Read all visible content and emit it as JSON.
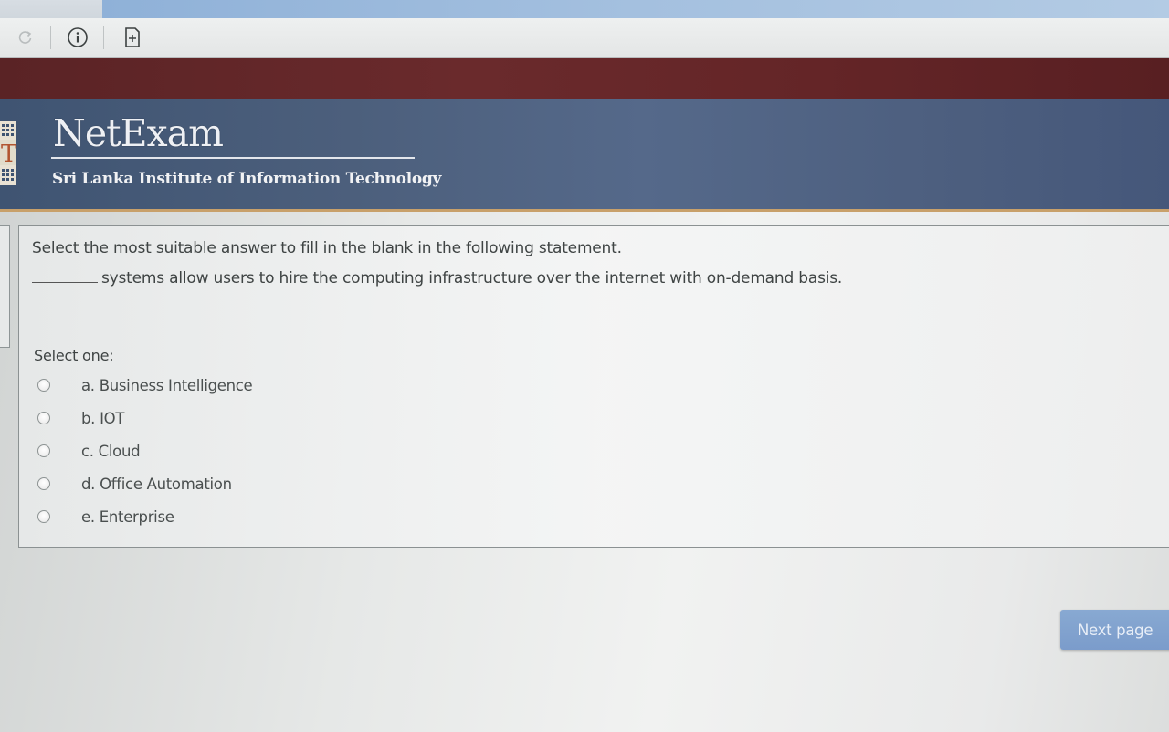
{
  "browser": {
    "reload_icon": "reload-icon",
    "info_icon": "info-icon",
    "page_icon": "add-page-icon"
  },
  "header": {
    "brand": "NetExam",
    "institution": "Sri Lanka Institute of Information Technology",
    "logo_letter": "T",
    "band_color": "#632527",
    "banner_color": "#4d6080"
  },
  "question": {
    "prompt": "Select the most suitable answer to fill in the blank in the following statement.",
    "statement": "systems allow users to hire the computing infrastructure over the internet with on-demand basis.",
    "select_label": "Select one:",
    "options": [
      {
        "label": "a. Business Intelligence"
      },
      {
        "label": "b. IOT"
      },
      {
        "label": "c. Cloud"
      },
      {
        "label": "d. Office Automation"
      },
      {
        "label": "e. Enterprise"
      }
    ]
  },
  "navigation": {
    "next_label": "Next page",
    "button_color": "#7f9fcd"
  }
}
